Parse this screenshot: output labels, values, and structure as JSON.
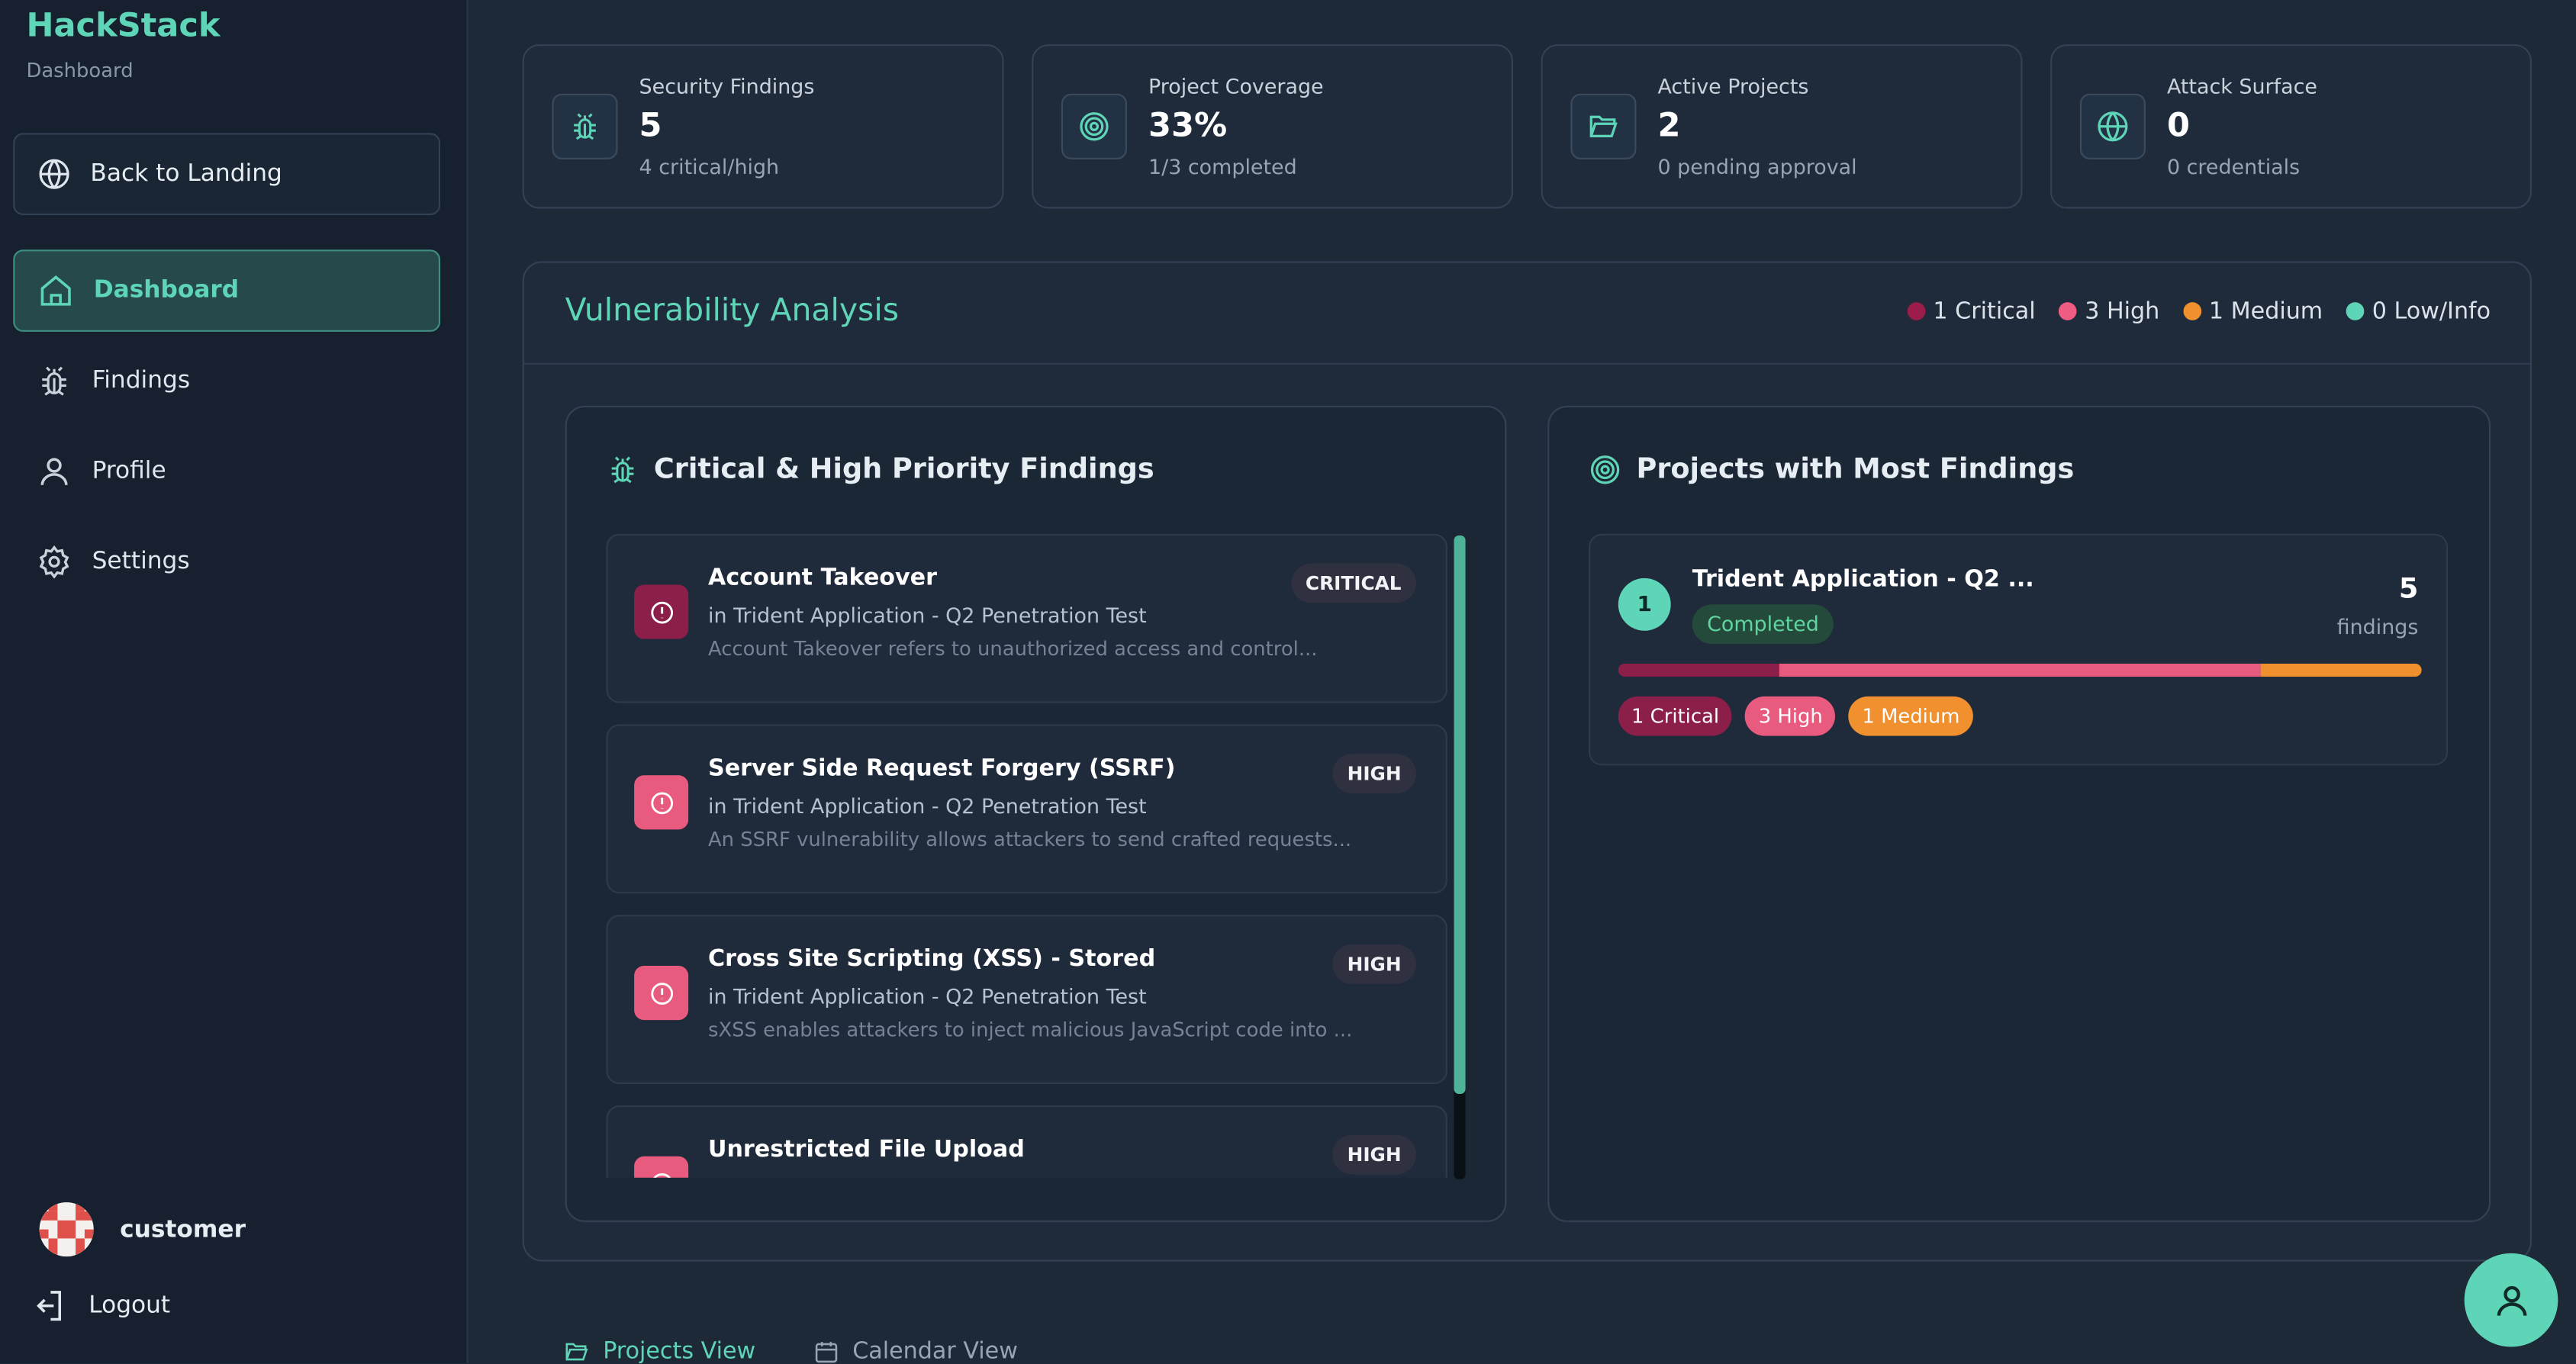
{
  "app": {
    "name": "HackStack",
    "section": "Dashboard"
  },
  "sidebar": {
    "back_label": "Back to Landing",
    "items": [
      {
        "label": "Dashboard",
        "icon": "home-icon",
        "active": true
      },
      {
        "label": "Findings",
        "icon": "bug-icon",
        "active": false
      },
      {
        "label": "Profile",
        "icon": "user-icon",
        "active": false
      },
      {
        "label": "Settings",
        "icon": "gear-icon",
        "active": false
      }
    ],
    "user": {
      "name": "customer"
    },
    "logout_label": "Logout"
  },
  "stats": [
    {
      "label": "Security Findings",
      "value": "5",
      "sub": "4 critical/high",
      "icon": "bug-icon"
    },
    {
      "label": "Project Coverage",
      "value": "33%",
      "sub": "1/3 completed",
      "icon": "target-icon"
    },
    {
      "label": "Active Projects",
      "value": "2",
      "sub": "0 pending approval",
      "icon": "folder-icon"
    },
    {
      "label": "Attack Surface",
      "value": "0",
      "sub": "0 credentials",
      "icon": "globe-icon"
    }
  ],
  "analysis": {
    "title": "Vulnerability Analysis",
    "legend": [
      {
        "label": "1 Critical",
        "color": "#9b1b4a"
      },
      {
        "label": "3 High",
        "color": "#ef5b82"
      },
      {
        "label": "1 Medium",
        "color": "#f0902f"
      },
      {
        "label": "0 Low/Info",
        "color": "#5fd5b8"
      }
    ],
    "findings_panel": {
      "title": "Critical & High Priority Findings",
      "items": [
        {
          "title": "Account Takeover",
          "project": "in Trident Application - Q2 Penetration Test",
          "desc": "Account Takeover refers to unauthorized access and control...",
          "severity": "CRITICAL",
          "color": "#8c1f49"
        },
        {
          "title": "Server Side Request Forgery (SSRF)",
          "project": "in Trident Application - Q2 Penetration Test",
          "desc": "An SSRF vulnerability allows attackers to send crafted requests...",
          "severity": "HIGH",
          "color": "#e85b7f"
        },
        {
          "title": "Cross Site Scripting (XSS) - Stored",
          "project": "in Trident Application - Q2 Penetration Test",
          "desc": "sXSS enables attackers to inject malicious JavaScript code into ...",
          "severity": "HIGH",
          "color": "#e85b7f"
        },
        {
          "title": "Unrestricted File Upload",
          "project": "",
          "desc": "",
          "severity": "HIGH",
          "color": "#e85b7f"
        }
      ]
    },
    "projects_panel": {
      "title": "Projects with Most Findings",
      "items": [
        {
          "rank": "1",
          "name": "Trident Application - Q2 ...",
          "status": "Completed",
          "count": "5",
          "count_label": "findings",
          "breakdown": [
            {
              "label": "1 Critical",
              "count": 1,
              "color": "#8c1f49"
            },
            {
              "label": "3 High",
              "count": 3,
              "color": "#e85b7f"
            },
            {
              "label": "1 Medium",
              "count": 1,
              "color": "#f0902f"
            }
          ]
        }
      ]
    }
  },
  "views": [
    {
      "label": "Projects View",
      "icon": "folder-icon",
      "active": true
    },
    {
      "label": "Calendar View",
      "icon": "calendar-icon",
      "active": false
    }
  ]
}
